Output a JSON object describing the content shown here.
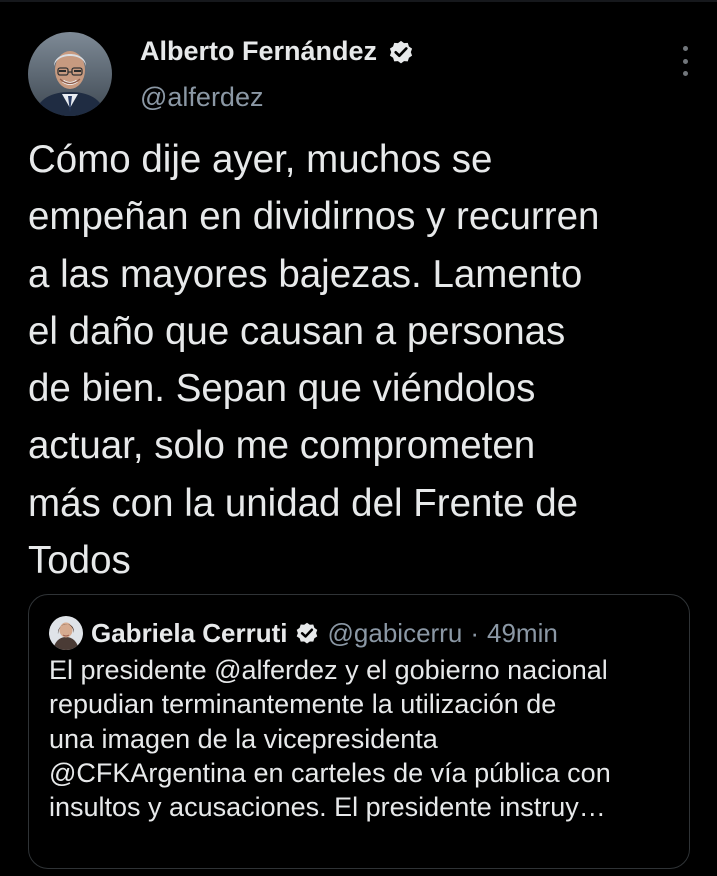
{
  "tweet": {
    "author": {
      "name": "Alberto Fernández",
      "handle": "@alferdez"
    },
    "text_lines": [
      "Cómo dije ayer, muchos se",
      "empeñan en dividirnos y recurren",
      "a las mayores bajezas. Lamento",
      "el daño que causan a personas",
      "de bien. Sepan que viéndolos",
      "actuar, solo me comprometen",
      "más con la unidad del Frente de",
      "Todos"
    ],
    "more_icon": "more-vertical-icon",
    "verified_icon": "verified-badge-icon"
  },
  "quoted_tweet": {
    "author": {
      "name": "Gabriela Cerruti",
      "handle": "@gabicerru"
    },
    "separator": "·",
    "time": "49min",
    "text_lines": [
      "El presidente @alferdez y el gobierno nacional",
      "repudian terminantemente la utilización de",
      "una imagen de la vicepresidenta",
      "@CFKArgentina en carteles de vía pública con",
      "insultos y acusaciones. El presidente instruy…"
    ]
  },
  "colors": {
    "background": "#000000",
    "text_primary": "#e7e9ea",
    "text_secondary": "#8b98a5",
    "border": "#2f3336"
  }
}
